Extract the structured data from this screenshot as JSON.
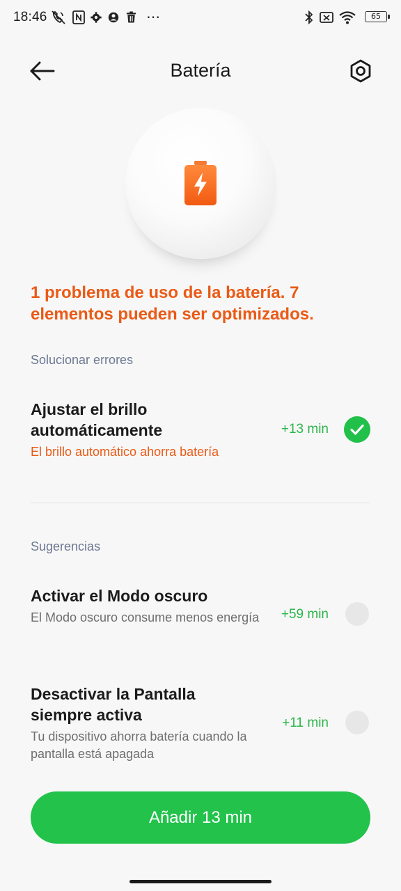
{
  "status_bar": {
    "time": "18:46",
    "overflow": "⋯",
    "battery_level": "65",
    "left_icons": [
      "call-muted-icon",
      "nfc-icon",
      "gear-icon",
      "account-icon",
      "trash-icon"
    ],
    "right_icons": [
      "bluetooth-icon",
      "no-sim-icon",
      "wifi-icon",
      "battery-icon"
    ]
  },
  "header": {
    "title": "Batería",
    "back_icon": "arrow-left-icon",
    "settings_icon": "settings-hex-icon"
  },
  "hero": {
    "icon": "battery-charging-icon",
    "accent": "#ff6a1f"
  },
  "summary": {
    "issue_text": "1 problema de uso de la batería.  7 elementos pueden ser optimizados."
  },
  "fix_section": {
    "label": "Solucionar errores",
    "items": [
      {
        "title": "Ajustar el brillo automáticamente",
        "subtitle": "El brillo automático ahorra batería",
        "gain": "+13 min",
        "checked": true
      }
    ]
  },
  "suggestions_section": {
    "label": "Sugerencias",
    "items": [
      {
        "title": "Activar el Modo oscuro",
        "subtitle": "El Modo oscuro consume menos energía",
        "gain": "+59 min",
        "checked": false
      },
      {
        "title": "Desactivar la Pantalla siempre activa",
        "subtitle": "Tu dispositivo ahorra batería cuando la pantalla está apagada",
        "gain": "+11 min",
        "checked": false
      }
    ]
  },
  "action": {
    "label": "Añadir 13 min"
  },
  "colors": {
    "accent_orange": "#ea5a16",
    "accent_green": "#22c24b",
    "background": "#f7f7f7"
  }
}
